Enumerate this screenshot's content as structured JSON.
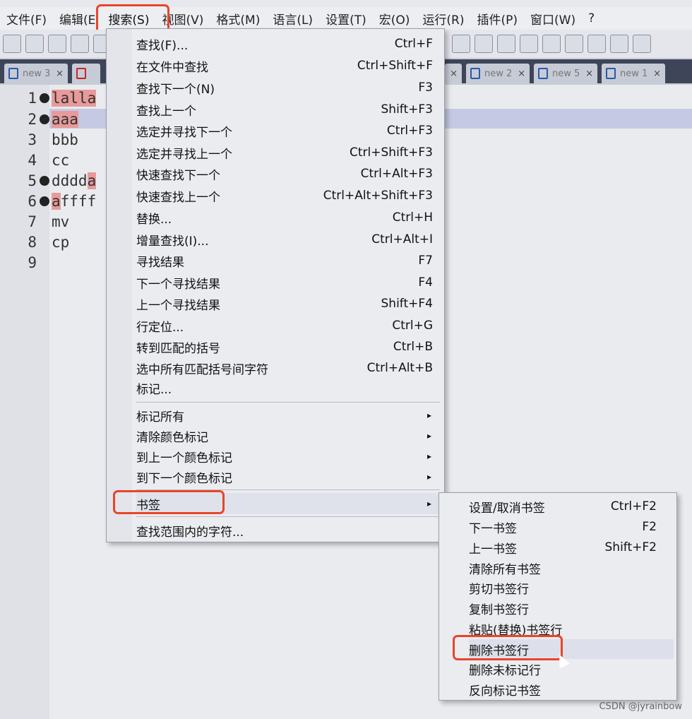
{
  "menubar": {
    "items": [
      "文件(F)",
      "编辑(E",
      "搜索(S)",
      "视图(V)",
      "格式(M)",
      "语言(L)",
      "设置(T)",
      "宏(O)",
      "运行(R)",
      "插件(P)",
      "窗口(W)",
      "?"
    ]
  },
  "tabs": [
    {
      "label": "new 3",
      "close": "×"
    },
    {
      "label": "",
      "close": ""
    },
    {
      "label": "",
      "close": "×"
    },
    {
      "label": "new 2",
      "close": "×"
    },
    {
      "label": "new 5",
      "close": "×"
    },
    {
      "label": "new 1",
      "close": "×"
    }
  ],
  "editor": {
    "lines": [
      {
        "num": "1",
        "bookmark": true,
        "text": "lalla",
        "highlight": "full"
      },
      {
        "num": "2",
        "bookmark": true,
        "text": "aaa",
        "highlight": "full"
      },
      {
        "num": "3",
        "bookmark": false,
        "text": "bbb",
        "highlight": "none"
      },
      {
        "num": "4",
        "bookmark": false,
        "text": "cc",
        "highlight": "none"
      },
      {
        "num": "5",
        "bookmark": true,
        "text": "dddda",
        "highlight": "last"
      },
      {
        "num": "6",
        "bookmark": true,
        "text": "affff",
        "highlight": "first"
      },
      {
        "num": "7",
        "bookmark": false,
        "text": "mv",
        "highlight": "none"
      },
      {
        "num": "8",
        "bookmark": false,
        "text": "cp",
        "highlight": "none"
      },
      {
        "num": "9",
        "bookmark": false,
        "text": "",
        "highlight": "none"
      }
    ]
  },
  "search_menu": {
    "items": [
      {
        "label": "查找(F)...",
        "shortcut": "Ctrl+F"
      },
      {
        "label": "在文件中查找",
        "shortcut": "Ctrl+Shift+F"
      },
      {
        "label": "查找下一个(N)",
        "shortcut": "F3"
      },
      {
        "label": "查找上一个",
        "shortcut": "Shift+F3"
      },
      {
        "label": "选定并寻找下一个",
        "shortcut": "Ctrl+F3"
      },
      {
        "label": "选定并寻找上一个",
        "shortcut": "Ctrl+Shift+F3"
      },
      {
        "label": "快速查找下一个",
        "shortcut": "Ctrl+Alt+F3"
      },
      {
        "label": "快速查找上一个",
        "shortcut": "Ctrl+Alt+Shift+F3"
      },
      {
        "label": "替换...",
        "shortcut": "Ctrl+H"
      },
      {
        "label": "增量查找(I)...",
        "shortcut": "Ctrl+Alt+I"
      },
      {
        "label": "寻找结果",
        "shortcut": "F7"
      },
      {
        "label": "下一个寻找结果",
        "shortcut": "F4"
      },
      {
        "label": "上一个寻找结果",
        "shortcut": "Shift+F4"
      },
      {
        "label": "行定位...",
        "shortcut": "Ctrl+G"
      },
      {
        "label": "转到匹配的括号",
        "shortcut": "Ctrl+B"
      },
      {
        "label": "选中所有匹配括号间字符",
        "shortcut": "Ctrl+Alt+B"
      },
      {
        "label": "标记...",
        "shortcut": ""
      }
    ],
    "submenu_items": [
      {
        "label": "标记所有",
        "arrow": "▸"
      },
      {
        "label": "清除颜色标记",
        "arrow": "▸"
      },
      {
        "label": "到上一个颜色标记",
        "arrow": "▸"
      },
      {
        "label": "到下一个颜色标记",
        "arrow": "▸"
      }
    ],
    "bookmark_item": {
      "label": "书签",
      "arrow": "▸"
    },
    "last_item": {
      "label": "查找范围内的字符...",
      "shortcut": ""
    }
  },
  "bookmark_submenu": {
    "items": [
      {
        "label": "设置/取消书签",
        "shortcut": "Ctrl+F2"
      },
      {
        "label": "下一书签",
        "shortcut": "F2"
      },
      {
        "label": "上一书签",
        "shortcut": "Shift+F2"
      },
      {
        "label": "清除所有书签",
        "shortcut": ""
      },
      {
        "label": "剪切书签行",
        "shortcut": ""
      },
      {
        "label": "复制书签行",
        "shortcut": ""
      },
      {
        "label": "粘贴(替换)书签行",
        "shortcut": ""
      },
      {
        "label": "删除书签行",
        "shortcut": ""
      },
      {
        "label": "删除未标记行",
        "shortcut": ""
      },
      {
        "label": "反向标记书签",
        "shortcut": ""
      }
    ]
  },
  "credit": "CSDN @jyrainbow",
  "colors": {
    "highlight_box": "#e8452a",
    "mark_highlight": "#e89a9a",
    "current_line": "#c6c9e3"
  }
}
